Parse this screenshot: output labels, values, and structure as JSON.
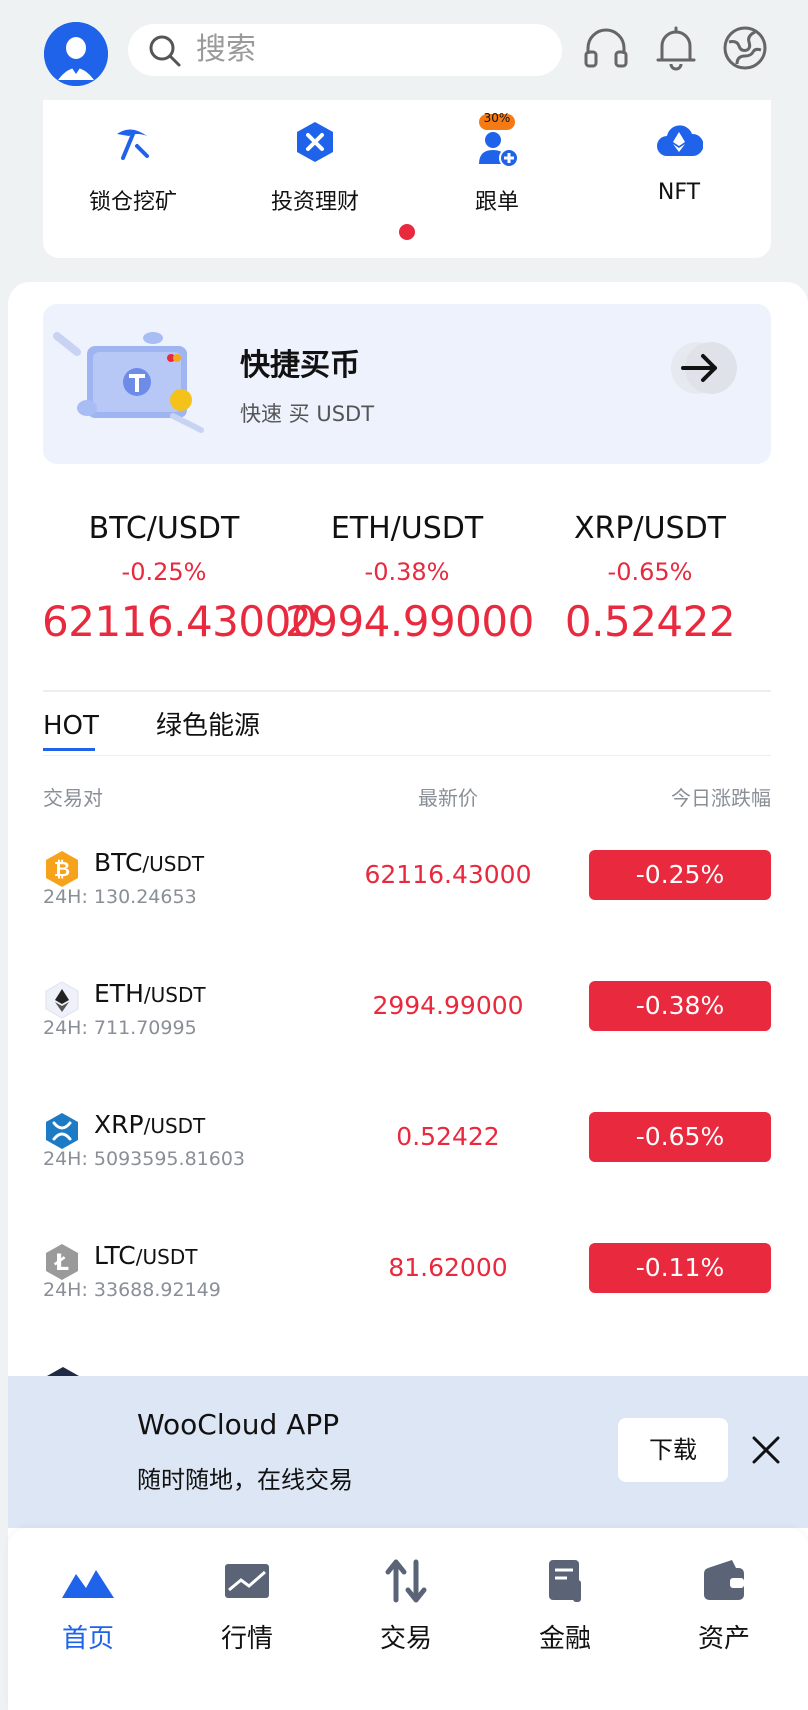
{
  "header": {
    "search_placeholder": "搜索"
  },
  "menu": [
    {
      "label": "锁仓挖矿",
      "icon": "pickaxe-icon"
    },
    {
      "label": "投资理财",
      "icon": "hexagon-x-icon"
    },
    {
      "label": "跟单",
      "icon": "user-plus-icon",
      "badge": "30%"
    },
    {
      "label": "NFT",
      "icon": "cloud-eth-icon"
    }
  ],
  "banner": {
    "title": "快捷买币",
    "subtitle": "快速 买 USDT"
  },
  "tickers": [
    {
      "pair": "BTC/USDT",
      "change": "-0.25%",
      "price": "62116.43000"
    },
    {
      "pair": "ETH/USDT",
      "change": "-0.38%",
      "price": "2994.99000"
    },
    {
      "pair": "XRP/USDT",
      "change": "-0.65%",
      "price": "0.52422"
    }
  ],
  "tabs": [
    "HOT",
    "绿色能源"
  ],
  "table_header": {
    "pair": "交易对",
    "price": "最新价",
    "change": "今日涨跌幅"
  },
  "rows": [
    {
      "base": "BTC",
      "quote": "/USDT",
      "vol": "24H: 130.24653",
      "price": "62116.43000",
      "change": "-0.25%",
      "icon": "bitcoin-icon"
    },
    {
      "base": "ETH",
      "quote": "/USDT",
      "vol": "24H: 711.70995",
      "price": "2994.99000",
      "change": "-0.38%",
      "icon": "ethereum-icon"
    },
    {
      "base": "XRP",
      "quote": "/USDT",
      "vol": "24H: 5093595.81603",
      "price": "0.52422",
      "change": "-0.65%",
      "icon": "xrp-icon"
    },
    {
      "base": "LTC",
      "quote": "/USDT",
      "vol": "24H: 33688.92149",
      "price": "81.62000",
      "change": "-0.11%",
      "icon": "litecoin-icon"
    }
  ],
  "download": {
    "title": "WooCloud APP",
    "subtitle": "随时随地，在线交易",
    "button": "下载"
  },
  "nav": [
    {
      "label": "首页",
      "icon": "home-mountain-icon",
      "active": true
    },
    {
      "label": "行情",
      "icon": "chart-icon"
    },
    {
      "label": "交易",
      "icon": "swap-arrows-icon"
    },
    {
      "label": "金融",
      "icon": "document-icon"
    },
    {
      "label": "资产",
      "icon": "wallet-icon"
    }
  ],
  "colors": {
    "accent": "#1e63e9",
    "down": "#e8293e"
  }
}
